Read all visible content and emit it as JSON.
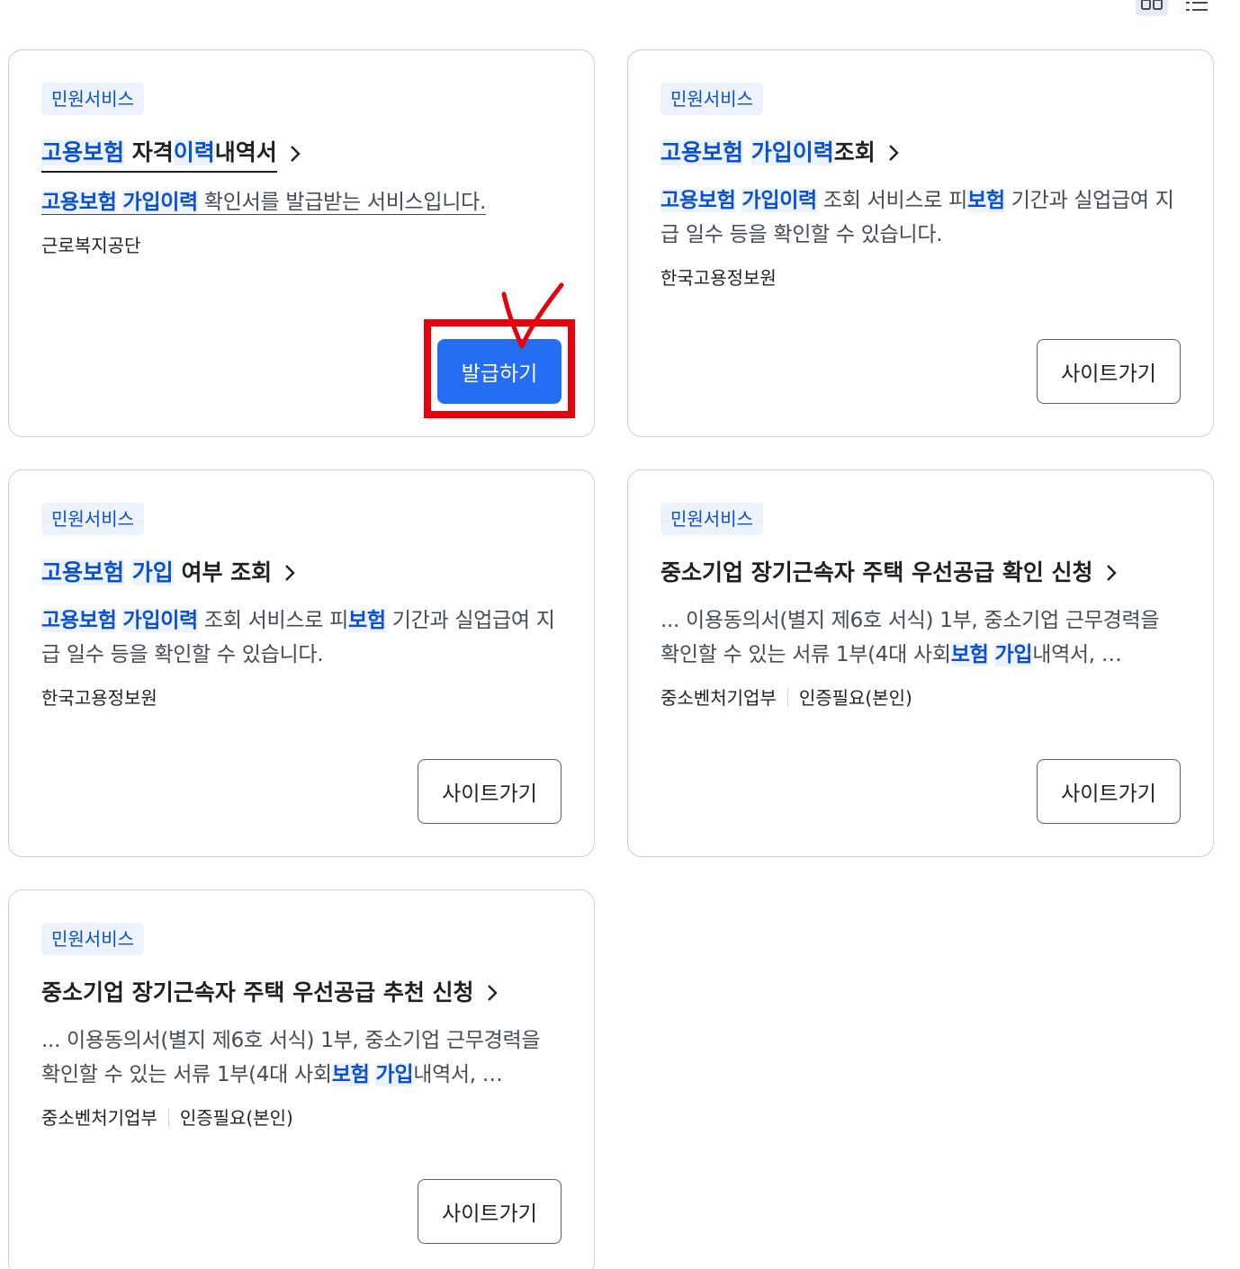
{
  "cards": [
    {
      "badge": "민원서비스",
      "title": [
        {
          "t": "고용보험",
          "h": true
        },
        {
          "t": " 자격",
          "h": false
        },
        {
          "t": "이력",
          "h": true
        },
        {
          "t": "내역서",
          "h": false
        }
      ],
      "desc": [
        {
          "t": "고용보험",
          "h": true
        },
        {
          "t": " ",
          "h": false
        },
        {
          "t": "가입이력",
          "h": true
        },
        {
          "t": " 확인서를 발급받는 서비스입니다.",
          "h": false
        }
      ],
      "meta": [
        "근로복지공단"
      ],
      "button": "발급하기"
    },
    {
      "badge": "민원서비스",
      "title": [
        {
          "t": "고용보험",
          "h": true
        },
        {
          "t": " ",
          "h": false
        },
        {
          "t": "가입이력",
          "h": true
        },
        {
          "t": "조회",
          "h": false
        }
      ],
      "desc": [
        {
          "t": "고용보험",
          "h": true
        },
        {
          "t": " ",
          "h": false
        },
        {
          "t": "가입이력",
          "h": true
        },
        {
          "t": " 조회 서비스로 피",
          "h": false
        },
        {
          "t": "보험",
          "h": true
        },
        {
          "t": " 기간과 실업급여 지급 일수 등을 확인할 수 있습니다.",
          "h": false
        }
      ],
      "meta": [
        "한국고용정보원"
      ],
      "button": "사이트가기"
    },
    {
      "badge": "민원서비스",
      "title": [
        {
          "t": "고용보험",
          "h": true
        },
        {
          "t": " ",
          "h": false
        },
        {
          "t": "가입",
          "h": true
        },
        {
          "t": " 여부 조회",
          "h": false
        }
      ],
      "desc": [
        {
          "t": "고용보험",
          "h": true
        },
        {
          "t": " ",
          "h": false
        },
        {
          "t": "가입이력",
          "h": true
        },
        {
          "t": " 조회 서비스로 피",
          "h": false
        },
        {
          "t": "보험",
          "h": true
        },
        {
          "t": " 기간과 실업급여 지급 일수 등을 확인할 수 있습니다.",
          "h": false
        }
      ],
      "meta": [
        "한국고용정보원"
      ],
      "button": "사이트가기"
    },
    {
      "badge": "민원서비스",
      "title": [
        {
          "t": "중소기업 장기근속자 주택 우선공급 확인 신청",
          "h": false
        }
      ],
      "desc": [
        {
          "t": "... 이용동의서(별지 제6호 서식) 1부, 중소기업 근무경력을 확인할 수 있는 서류 1부(4대 사회",
          "h": false
        },
        {
          "t": "보험",
          "h": true
        },
        {
          "t": " ",
          "h": false
        },
        {
          "t": "가입",
          "h": true
        },
        {
          "t": "내역서, …",
          "h": false
        }
      ],
      "meta": [
        "중소벤처기업부",
        "인증필요(본인)"
      ],
      "button": "사이트가기"
    },
    {
      "badge": "민원서비스",
      "title": [
        {
          "t": "중소기업 장기근속자 주택 우선공급 추천 신청",
          "h": false
        }
      ],
      "desc": [
        {
          "t": "... 이용동의서(별지 제6호 서식) 1부, 중소기업 근무경력을 확인할 수 있는 서류 1부(4대 사회",
          "h": false
        },
        {
          "t": "보험",
          "h": true
        },
        {
          "t": " ",
          "h": false
        },
        {
          "t": "가입",
          "h": true
        },
        {
          "t": "내역서, …",
          "h": false
        }
      ],
      "meta": [
        "중소벤처기업부",
        "인증필요(본인)"
      ],
      "button": "사이트가기"
    }
  ],
  "toolbar": {
    "grid_view_icon": "grid-view-icon",
    "list_view_icon": "list-view-icon"
  },
  "colors": {
    "highlight": "#0b50d0",
    "primary_button": "#256ef4",
    "annotation": "#e8000b"
  }
}
